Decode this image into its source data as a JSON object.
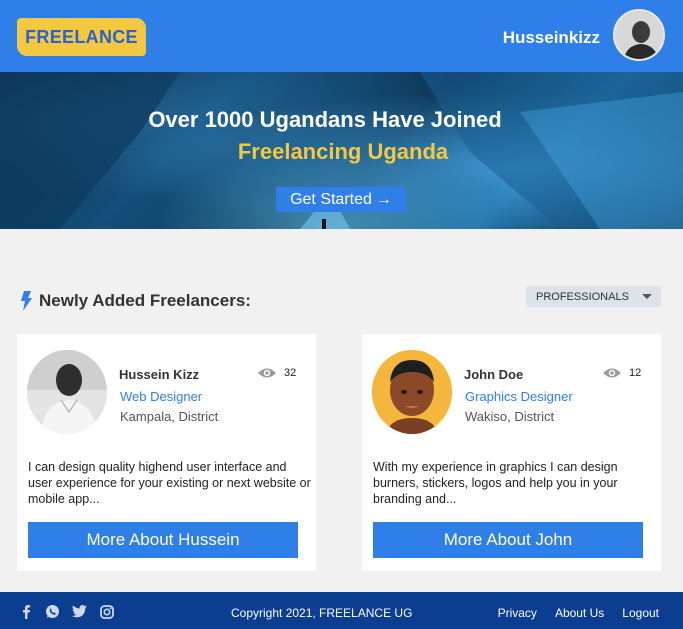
{
  "header": {
    "logo": "FREELANCE",
    "username": "Husseinkizz"
  },
  "hero": {
    "title": "Over 1000 Ugandans Have Joined",
    "subtitle": "Freelancing Uganda",
    "cta_label": "Get Started",
    "cta_arrow": "→"
  },
  "section": {
    "title": "Newly Added Freelancers:",
    "filter_selected": "PROFESSIONALS"
  },
  "cards": [
    {
      "name": "Hussein Kizz",
      "role": "Web Designer",
      "location": "Kampala, District",
      "views": "32",
      "description": "I can design quality highend user interface and user experience for your existing or next website or mobile app...",
      "button": "More About Hussein"
    },
    {
      "name": "John Doe",
      "role": "Graphics Designer",
      "location": "Wakiso, District",
      "views": "12",
      "description": "With my experience in graphics I can design burners, stickers, logos and help you in your branding and...",
      "button": "More About John"
    }
  ],
  "footer": {
    "copyright": "Copyright 2021, FREELANCE UG",
    "links": [
      "Privacy",
      "About Us",
      "Logout"
    ],
    "social_icons": [
      "facebook-icon",
      "whatsapp-icon",
      "twitter-icon",
      "instagram-icon"
    ]
  },
  "colors": {
    "primary": "#2f7fe8",
    "accent": "#f5c842",
    "footer": "#0b3d91"
  }
}
